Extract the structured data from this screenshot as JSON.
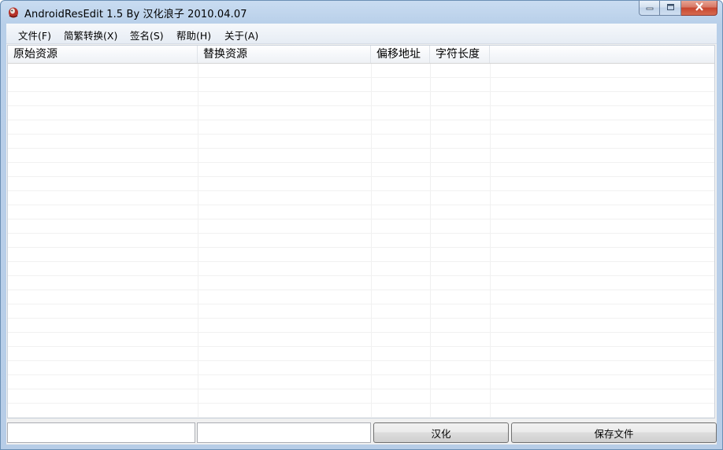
{
  "window": {
    "title": "AndroidResEdit 1.5 By 汉化浪子 2010.04.07"
  },
  "menu": [
    {
      "label": "文件(F)"
    },
    {
      "label": "简繁转换(X)"
    },
    {
      "label": "签名(S)"
    },
    {
      "label": "帮助(H)"
    },
    {
      "label": "关于(A)"
    }
  ],
  "table": {
    "columns": [
      "原始资源",
      "替换资源",
      "偏移地址",
      "字符长度"
    ],
    "rows": []
  },
  "bottom": {
    "input1": "",
    "input2": "",
    "localize_button": "汉化",
    "save_button": "保存文件"
  },
  "icons": {
    "app": "app-logo-icon",
    "minimize": "minimize-icon",
    "maximize": "maximize-icon",
    "close": "close-icon"
  }
}
